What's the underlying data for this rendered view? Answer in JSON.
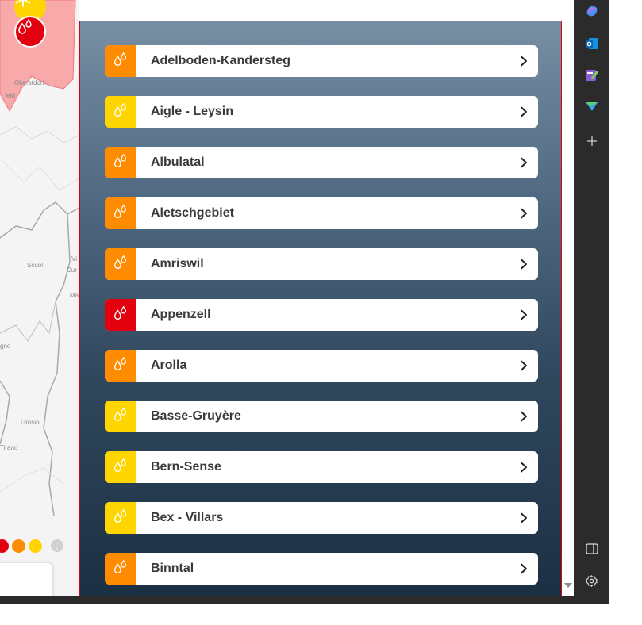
{
  "map": {
    "labels": [
      "Oberstdorf",
      "feld",
      "Scuol",
      "Vi",
      "Cur",
      "Ma",
      "gno",
      "Grosio",
      "Tirano"
    ]
  },
  "level_colors": {
    "orange": "#ff8c00",
    "yellow": "#ffd500",
    "red": "#e2000f"
  },
  "regions": [
    {
      "name": "Adelboden-Kandersteg",
      "level": "orange",
      "icon": "avalanche-drops-icon"
    },
    {
      "name": "Aigle - Leysin",
      "level": "yellow",
      "icon": "avalanche-drops-icon"
    },
    {
      "name": "Albulatal",
      "level": "orange",
      "icon": "avalanche-drops-icon"
    },
    {
      "name": "Aletschgebiet",
      "level": "orange",
      "icon": "avalanche-drops-icon"
    },
    {
      "name": "Amriswil",
      "level": "orange",
      "icon": "avalanche-drops-icon"
    },
    {
      "name": "Appenzell",
      "level": "red",
      "icon": "avalanche-drops-icon"
    },
    {
      "name": "Arolla",
      "level": "orange",
      "icon": "avalanche-drops-icon"
    },
    {
      "name": "Basse-Gruyère",
      "level": "yellow",
      "icon": "avalanche-drops-icon"
    },
    {
      "name": "Bern-Sense",
      "level": "yellow",
      "icon": "avalanche-drops-icon"
    },
    {
      "name": "Bex - Villars",
      "level": "yellow",
      "icon": "avalanche-drops-icon"
    },
    {
      "name": "Binntal",
      "level": "orange",
      "icon": "avalanche-drops-icon"
    }
  ],
  "edge_sidebar": {
    "icons": [
      "copilot-icon",
      "outlook-icon",
      "designer-icon",
      "send-icon",
      "add-icon",
      "split-screen-icon",
      "settings-icon"
    ]
  }
}
